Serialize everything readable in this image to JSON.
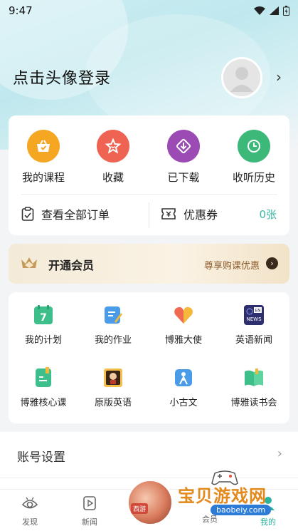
{
  "status": {
    "time": "9:47"
  },
  "login": {
    "prompt": "点击头像登录"
  },
  "quick_actions": [
    {
      "label": "我的课程",
      "icon": "basket-icon",
      "color": "#f5a623"
    },
    {
      "label": "收藏",
      "icon": "star-icon",
      "color": "#ef6352"
    },
    {
      "label": "已下载",
      "icon": "download-icon",
      "color": "#9b4bb3"
    },
    {
      "label": "收听历史",
      "icon": "clock-icon",
      "color": "#3cb879"
    }
  ],
  "orders": {
    "label": "查看全部订单"
  },
  "coupon": {
    "label": "优惠券",
    "count": "0张"
  },
  "vip": {
    "title": "开通会员",
    "subtitle": "尊享购课优惠"
  },
  "features": [
    {
      "label": "我的计划",
      "icon": "calendar-icon"
    },
    {
      "label": "我的作业",
      "icon": "homework-icon"
    },
    {
      "label": "博雅大使",
      "icon": "heart-icon"
    },
    {
      "label": "英语新闻",
      "icon": "news-icon"
    },
    {
      "label": "博雅核心课",
      "icon": "core-course-icon"
    },
    {
      "label": "原版英语",
      "icon": "original-english-icon"
    },
    {
      "label": "小古文",
      "icon": "ancient-text-icon"
    },
    {
      "label": "博雅读书会",
      "icon": "book-club-icon"
    }
  ],
  "settings": {
    "account": "账号设置"
  },
  "tabs": [
    {
      "label": "发现"
    },
    {
      "label": "新闻"
    },
    {
      "label": "会员"
    },
    {
      "label": "我的"
    }
  ],
  "watermark": {
    "title": "宝贝游戏网",
    "url": "baobeiy.com",
    "badge": "西游"
  }
}
